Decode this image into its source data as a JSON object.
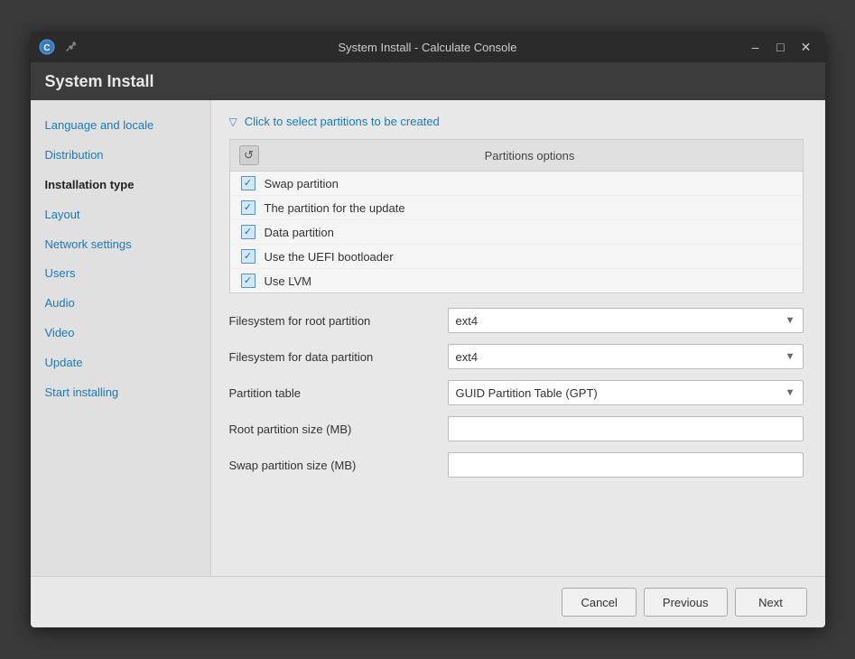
{
  "window": {
    "title": "System Install - Calculate Console"
  },
  "header": {
    "title": "System Install"
  },
  "sidebar": {
    "items": [
      {
        "id": "language-locale",
        "label": "Language and locale",
        "active": false
      },
      {
        "id": "distribution",
        "label": "Distribution",
        "active": false
      },
      {
        "id": "installation-type",
        "label": "Installation type",
        "active": true
      },
      {
        "id": "layout",
        "label": "Layout",
        "active": false
      },
      {
        "id": "network-settings",
        "label": "Network settings",
        "active": false
      },
      {
        "id": "users",
        "label": "Users",
        "active": false
      },
      {
        "id": "audio",
        "label": "Audio",
        "active": false
      },
      {
        "id": "video",
        "label": "Video",
        "active": false
      },
      {
        "id": "update",
        "label": "Update",
        "active": false
      },
      {
        "id": "start-installing",
        "label": "Start installing",
        "active": false
      }
    ]
  },
  "main": {
    "section_link": "Click to select partitions to be created",
    "partitions_header": "Partitions options",
    "partitions": [
      {
        "label": "Swap partition"
      },
      {
        "label": "The partition for the update"
      },
      {
        "label": "Data partition"
      },
      {
        "label": "Use the UEFI bootloader"
      },
      {
        "label": "Use LVM"
      }
    ],
    "form_fields": [
      {
        "label": "Filesystem for root partition",
        "type": "select",
        "value": "ext4"
      },
      {
        "label": "Filesystem for data partition",
        "type": "select",
        "value": "ext4"
      },
      {
        "label": "Partition table",
        "type": "select",
        "value": "GUID Partition Table (GPT)"
      },
      {
        "label": "Root partition size (MB)",
        "type": "input",
        "value": ""
      },
      {
        "label": "Swap partition size (MB)",
        "type": "input",
        "value": ""
      }
    ],
    "buttons": {
      "cancel": "Cancel",
      "previous": "Previous",
      "next": "Next"
    }
  }
}
